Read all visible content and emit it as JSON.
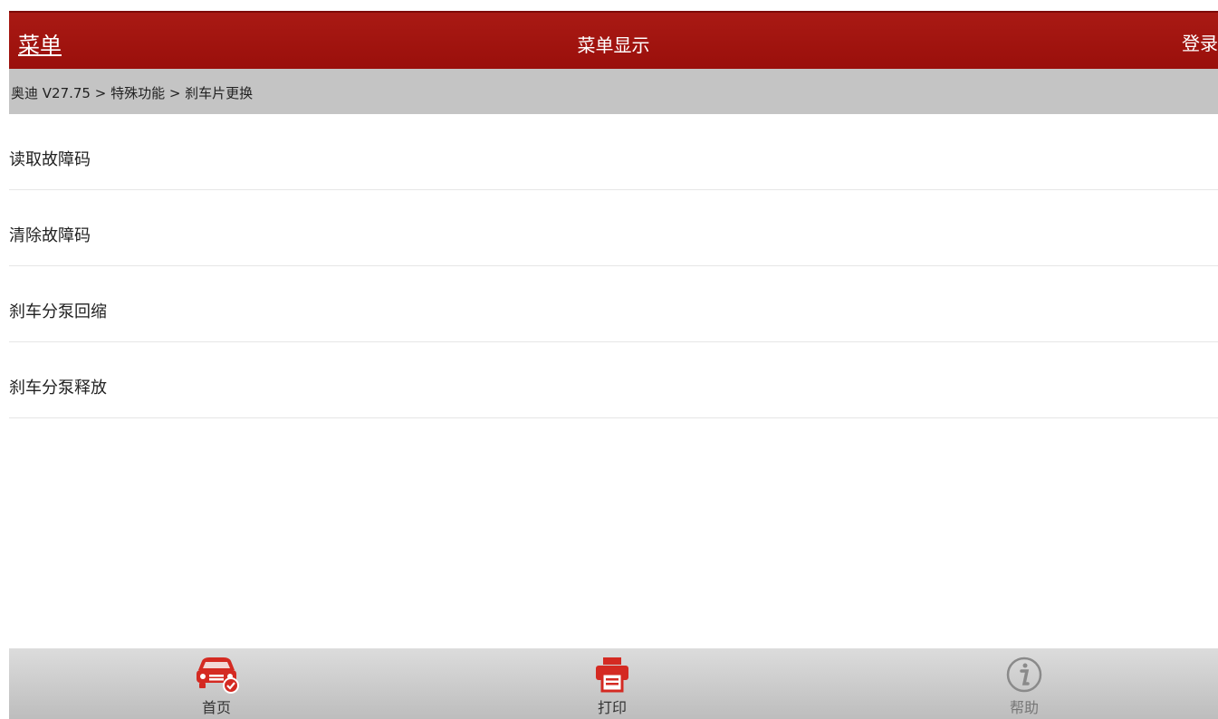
{
  "header": {
    "menu_label": "菜单",
    "title": "菜单显示",
    "login_label": "登录",
    "accent_color": "#a01510"
  },
  "breadcrumb": {
    "text": "奥迪 V27.75 > 特殊功能 > 刹车片更换"
  },
  "menu": {
    "items": [
      {
        "label": "读取故障码"
      },
      {
        "label": "清除故障码"
      },
      {
        "label": "刹车分泵回缩"
      },
      {
        "label": "刹车分泵释放"
      }
    ]
  },
  "footer": {
    "home_label": "首页",
    "home_icon": "car-check-icon",
    "print_label": "打印",
    "print_icon": "printer-icon",
    "help_label": "帮助",
    "help_icon": "info-icon"
  }
}
